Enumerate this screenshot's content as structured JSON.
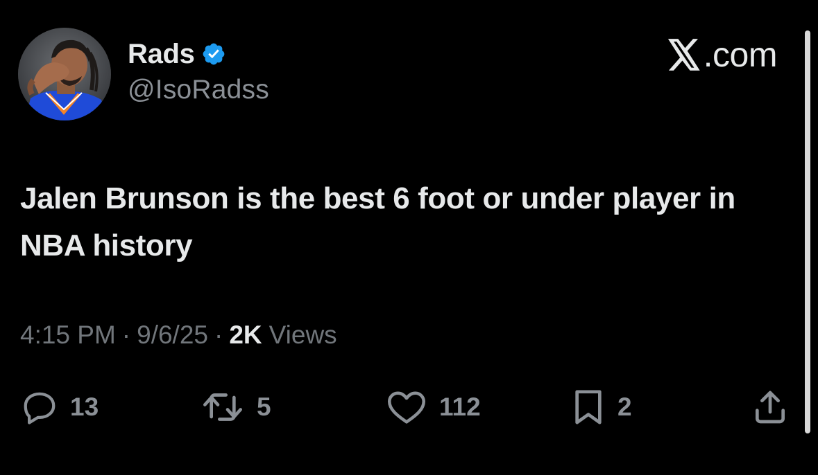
{
  "author": {
    "display_name": "Rads",
    "handle": "@IsoRadss",
    "verified": true,
    "verified_color": "#1d9bf0",
    "avatar_icon": "avatar-photo"
  },
  "brand": {
    "text": ".com",
    "icon": "x-logo-icon"
  },
  "tweet": {
    "text": "Jalen Brunson is the best 6 foot or under player in NBA history"
  },
  "meta": {
    "time": "4:15 PM",
    "separator": "·",
    "date": "9/6/25",
    "views_count": "2K",
    "views_label": "Views"
  },
  "actions": {
    "reply_count": "13",
    "retweet_count": "5",
    "like_count": "112",
    "bookmark_count": "2"
  },
  "colors": {
    "background": "#000000",
    "primary_text": "#e7e9ea",
    "secondary_text": "#71767b",
    "icon": "#8b9096"
  }
}
